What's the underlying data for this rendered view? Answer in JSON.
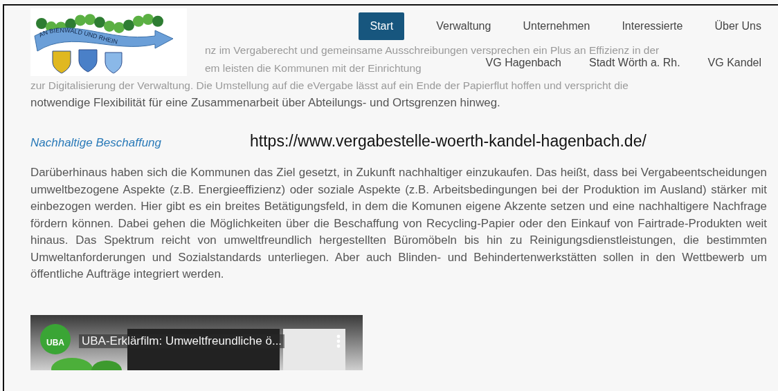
{
  "faded_text": [
    "nz im Vergaberecht und gemeinsame Ausschreibungen versprechen ein Plus an Effizienz in der",
    "em leisten die Kommunen mit der Einrichtung",
    "zur Digitalisierung der Verwaltung. Die Umstellung auf die eVergabe lässt auf ein Ende der Papierflut hoffen und verspricht die"
  ],
  "logo": {
    "text": "AN BIENWALD UND RHEIN"
  },
  "nav": {
    "main": [
      {
        "label": "Start",
        "selected": true
      },
      {
        "label": "Verwaltung",
        "selected": false
      },
      {
        "label": "Unternehmen",
        "selected": false
      },
      {
        "label": "Interessierte",
        "selected": false
      },
      {
        "label": "Über Uns",
        "selected": false
      }
    ],
    "sub": [
      {
        "label": "VG Hagenbach",
        "selected": false
      },
      {
        "label": "Stadt Wörth a. Rh.",
        "selected": false
      },
      {
        "label": "VG Kandel",
        "selected": false
      }
    ]
  },
  "intro_end": "notwendige Flexibilität für eine Zusammenarbeit über Abteilungs- und Ortsgrenzen hinweg.",
  "section": {
    "heading": "Nachhaltige Beschaffung",
    "url": "https://www.vergabestelle-woerth-kandel-hagenbach.de/",
    "paragraph": "Darüberhinaus haben sich die Kommunen das Ziel gesetzt, in Zukunft nachhaltiger einzukaufen. Das heißt, dass bei Vergabeentscheidungen umweltbezogene Aspekte (z.B. Energieeffizienz) oder soziale Aspekte (z.B. Arbeitsbedingungen bei der Produktion im Ausland) stärker mit einbezogen werden. Hier gibt es ein breites Betätigungsfeld, in dem die Komunen eigene  Akzente setzen und eine nachhaltigere Nachfrage fördern können. Dabei gehen die Möglichkeiten über die Beschaffung von Recycling-Papier oder den Einkauf von Fairtrade-Produkten weit hinaus. Das Spektrum reicht von umweltfreundlich hergestellten Büromöbeln bis hin zu Reinigungsdienstleistungen, die bestimmten Umweltanforderungen und Sozialstandards unterliegen. Aber auch Blinden- und Behindertenwerkstätten sollen in den Wettbewerb um öffentliche Aufträge integriert werden."
  },
  "video": {
    "channel": "UBA",
    "title": "UBA-Erklärfilm: Umweltfreundliche ö..."
  }
}
